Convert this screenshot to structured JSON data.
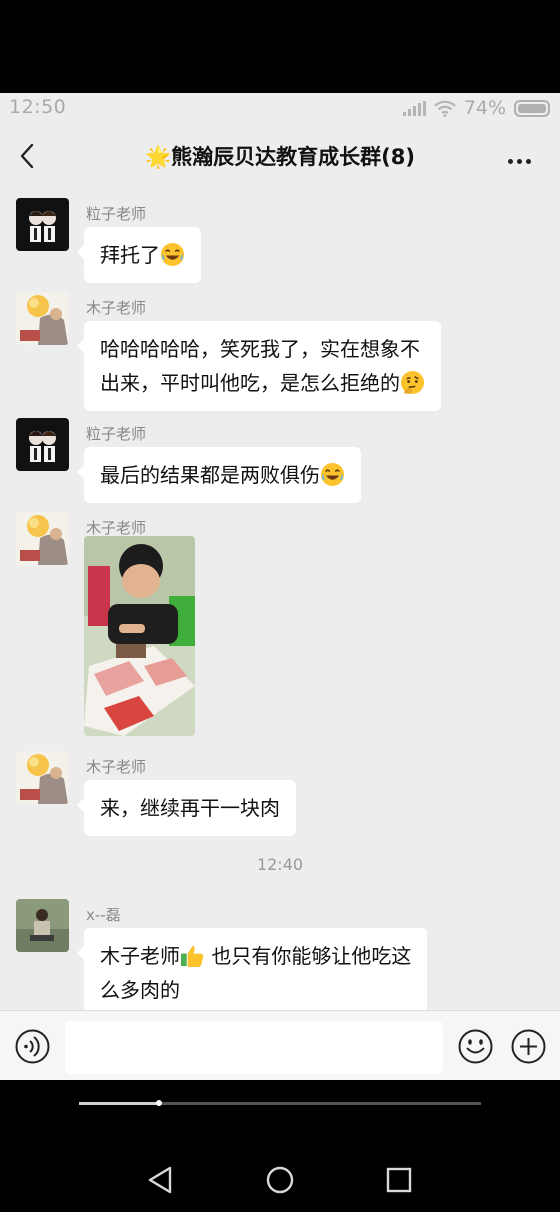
{
  "status_bar": {
    "time": "12:50",
    "battery": "74%"
  },
  "header": {
    "title": "🌟熊瀚辰贝达教育成长群(8)"
  },
  "messages": [
    {
      "sender": "粒子老师",
      "text": "拜托了"
    },
    {
      "sender": "木子老师",
      "text1": "哈哈哈哈哈，笑死我了，实在想象不",
      "text2": "出来，平时叫他吃，是怎么拒绝的"
    },
    {
      "sender": "粒子老师",
      "text": "最后的结果都是两败俱伤"
    },
    {
      "sender": "木子老师"
    },
    {
      "sender": "木子老师",
      "text": "来，继续再干一块肉"
    },
    {
      "sender": "x--磊",
      "text1a": "木子老师",
      "text1b": " 也只有你能够让他吃这",
      "text2": "么多肉的"
    }
  ],
  "timestamp": "12:40",
  "icons": [
    "back-icon",
    "more-icon",
    "voice-icon",
    "emoji-face-icon",
    "plus-icon",
    "nav-back-icon",
    "nav-home-icon",
    "nav-recents-icon"
  ],
  "colors": {
    "chat_bg": "#ededed",
    "bubble": "#ffffff",
    "input_bar": "#f6f6f6"
  },
  "scroll_progress": 0.2
}
